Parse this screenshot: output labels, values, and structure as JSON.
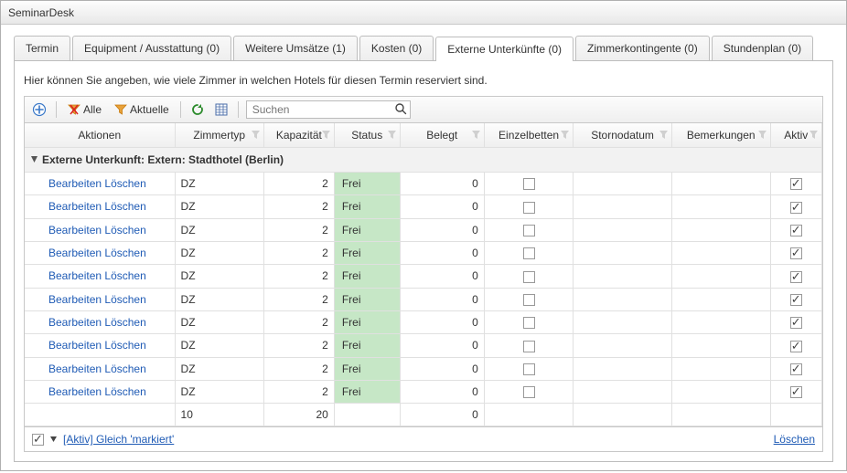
{
  "window": {
    "title": "SeminarDesk"
  },
  "tabs": [
    {
      "label": "Termin"
    },
    {
      "label": "Equipment / Ausstattung (0)"
    },
    {
      "label": "Weitere Umsätze (1)"
    },
    {
      "label": "Kosten (0)"
    },
    {
      "label": "Externe Unterkünfte (0)",
      "active": true
    },
    {
      "label": "Zimmerkontingente (0)"
    },
    {
      "label": "Stundenplan (0)"
    }
  ],
  "panel": {
    "description": "Hier können Sie angeben, wie viele Zimmer in welchen Hotels für diesen Termin reserviert sind."
  },
  "toolbar": {
    "all_label": "Alle",
    "current_label": "Aktuelle",
    "search_placeholder": "Suchen"
  },
  "columns": {
    "actions": "Aktionen",
    "roomtype": "Zimmertyp",
    "capacity": "Kapazität",
    "status": "Status",
    "occupied": "Belegt",
    "singlebeds": "Einzelbetten",
    "canceldate": "Stornodatum",
    "notes": "Bemerkungen",
    "active": "Aktiv"
  },
  "group": {
    "label": "Externe Unterkunft: Extern: Stadthotel (Berlin)"
  },
  "actions": {
    "edit": "Bearbeiten",
    "delete": "Löschen"
  },
  "rows": [
    {
      "roomtype": "DZ",
      "capacity": "2",
      "status": "Frei",
      "occupied": "0",
      "singlebeds": false,
      "active": true
    },
    {
      "roomtype": "DZ",
      "capacity": "2",
      "status": "Frei",
      "occupied": "0",
      "singlebeds": false,
      "active": true
    },
    {
      "roomtype": "DZ",
      "capacity": "2",
      "status": "Frei",
      "occupied": "0",
      "singlebeds": false,
      "active": true
    },
    {
      "roomtype": "DZ",
      "capacity": "2",
      "status": "Frei",
      "occupied": "0",
      "singlebeds": false,
      "active": true
    },
    {
      "roomtype": "DZ",
      "capacity": "2",
      "status": "Frei",
      "occupied": "0",
      "singlebeds": false,
      "active": true
    },
    {
      "roomtype": "DZ",
      "capacity": "2",
      "status": "Frei",
      "occupied": "0",
      "singlebeds": false,
      "active": true
    },
    {
      "roomtype": "DZ",
      "capacity": "2",
      "status": "Frei",
      "occupied": "0",
      "singlebeds": false,
      "active": true
    },
    {
      "roomtype": "DZ",
      "capacity": "2",
      "status": "Frei",
      "occupied": "0",
      "singlebeds": false,
      "active": true
    },
    {
      "roomtype": "DZ",
      "capacity": "2",
      "status": "Frei",
      "occupied": "0",
      "singlebeds": false,
      "active": true
    },
    {
      "roomtype": "DZ",
      "capacity": "2",
      "status": "Frei",
      "occupied": "0",
      "singlebeds": false,
      "active": true
    }
  ],
  "summary": {
    "count": "10",
    "capacity": "20",
    "occupied": "0"
  },
  "footer": {
    "filter_text": "[Aktiv] Gleich 'markiert'",
    "delete_label": "Löschen"
  }
}
